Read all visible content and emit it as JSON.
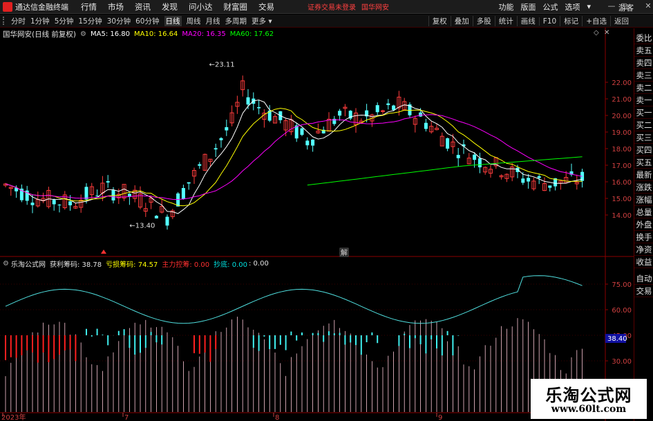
{
  "app": {
    "title": "通达信金融终端"
  },
  "menu": [
    "行情",
    "市场",
    "资讯",
    "发现",
    "问小达",
    "财富圈",
    "交易"
  ],
  "login_status": "证券交易未登录",
  "stock_title": "国华网安",
  "right_menu": [
    "功能",
    "版面",
    "公式",
    "选项"
  ],
  "guest_label": "游客",
  "periods": [
    "分时",
    "1分钟",
    "5分钟",
    "15分钟",
    "30分钟",
    "60分钟",
    "日线",
    "周线",
    "月线",
    "多周期"
  ],
  "active_period": "日线",
  "more_label": "更多",
  "tool_buttons": [
    "复权",
    "叠加",
    "多股",
    "统计",
    "画线",
    "F10",
    "标记",
    "+自选",
    "返回"
  ],
  "side_tabs": [
    "委比",
    "卖五",
    "卖四",
    "卖三",
    "卖二",
    "卖一",
    "买一",
    "买二",
    "买三",
    "买四",
    "买五",
    "最新",
    "涨跌",
    "涨幅",
    "总量",
    "外盘",
    "换手",
    "净资",
    "收益",
    "",
    "自动",
    "交易"
  ],
  "info": {
    "stock_name_period": "国华网安(日线 前复权)",
    "ma": [
      {
        "label": "MA5: 16.80",
        "color": "#ffffff"
      },
      {
        "label": "MA10: 16.64",
        "color": "#ffff00"
      },
      {
        "label": "MA20: 16.35",
        "color": "#ff00ff"
      },
      {
        "label": "MA60: 17.62",
        "color": "#00ff00"
      }
    ]
  },
  "indicator": {
    "name": "乐淘公式网",
    "items": [
      {
        "label": "获利筹码: 38.78",
        "color": "#e0e0e0"
      },
      {
        "label": "亏损筹码: 74.57",
        "color": "#ffff00"
      },
      {
        "label": "主力控筹: 0.00",
        "color": "#ff3030"
      },
      {
        "label": "抄底: 0.00",
        "color": "#00e0e0"
      },
      {
        "label": ": 0.00",
        "color": "#e0e0e0"
      }
    ],
    "badge": "38.40"
  },
  "price_axis": [
    "22.00",
    "21.00",
    "20.00",
    "19.00",
    "18.00",
    "17.00",
    "16.00",
    "15.00",
    "14.00"
  ],
  "ind_axis": [
    "75.00",
    "60.00",
    "45.00",
    "30.00"
  ],
  "annotations": {
    "high": "23.11",
    "low": "13.40",
    "event": "解"
  },
  "time_axis": [
    "2023年",
    "7",
    "8",
    "9"
  ],
  "watermark": {
    "title": "乐淘公式网",
    "url": "www.60lt.com"
  },
  "colors": {
    "up": "#ff3c3c",
    "down": "#54ffff",
    "axis": "#8b0000",
    "ma5": "#ffffff",
    "ma10": "#ffff00",
    "ma20": "#ff00ff",
    "ma60": "#00ff00"
  }
}
